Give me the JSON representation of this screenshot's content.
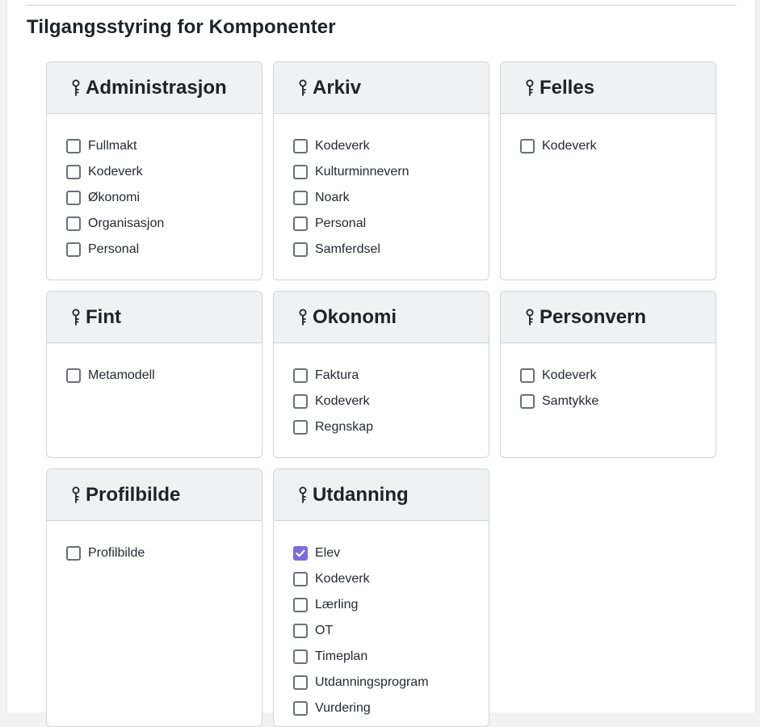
{
  "section_title": "Tilgangsstyring for Komponenter",
  "accent_color": "#7b6bde",
  "icon": "key-icon",
  "cards": [
    {
      "title": "Administrasjon",
      "items": [
        {
          "label": "Fullmakt",
          "checked": false
        },
        {
          "label": "Kodeverk",
          "checked": false
        },
        {
          "label": "Økonomi",
          "checked": false
        },
        {
          "label": "Organisasjon",
          "checked": false
        },
        {
          "label": "Personal",
          "checked": false
        }
      ]
    },
    {
      "title": "Arkiv",
      "items": [
        {
          "label": "Kodeverk",
          "checked": false
        },
        {
          "label": "Kulturminnevern",
          "checked": false
        },
        {
          "label": "Noark",
          "checked": false
        },
        {
          "label": "Personal",
          "checked": false
        },
        {
          "label": "Samferdsel",
          "checked": false
        }
      ]
    },
    {
      "title": "Felles",
      "items": [
        {
          "label": "Kodeverk",
          "checked": false
        }
      ]
    },
    {
      "title": "Fint",
      "items": [
        {
          "label": "Metamodell",
          "checked": false
        }
      ]
    },
    {
      "title": "Okonomi",
      "items": [
        {
          "label": "Faktura",
          "checked": false
        },
        {
          "label": "Kodeverk",
          "checked": false
        },
        {
          "label": "Regnskap",
          "checked": false
        }
      ]
    },
    {
      "title": "Personvern",
      "items": [
        {
          "label": "Kodeverk",
          "checked": false
        },
        {
          "label": "Samtykke",
          "checked": false
        }
      ]
    },
    {
      "title": "Profilbilde",
      "items": [
        {
          "label": "Profilbilde",
          "checked": false
        }
      ]
    },
    {
      "title": "Utdanning",
      "items": [
        {
          "label": "Elev",
          "checked": true
        },
        {
          "label": "Kodeverk",
          "checked": false
        },
        {
          "label": "Lærling",
          "checked": false
        },
        {
          "label": "OT",
          "checked": false
        },
        {
          "label": "Timeplan",
          "checked": false
        },
        {
          "label": "Utdanningsprogram",
          "checked": false
        },
        {
          "label": "Vurdering",
          "checked": false
        }
      ]
    }
  ]
}
